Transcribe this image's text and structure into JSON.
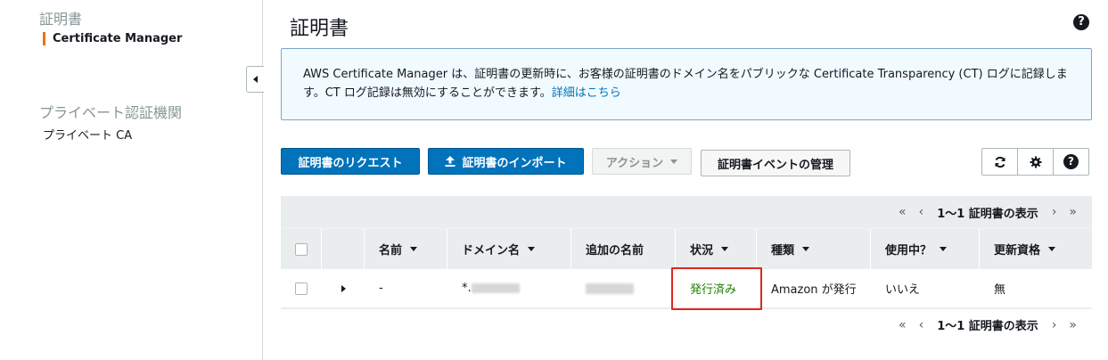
{
  "sidebar": {
    "section1": "証明書",
    "item_cm": "Certificate Manager",
    "section2": "プライベート認証機関",
    "item_ca": "プライベート CA"
  },
  "header": {
    "title": "証明書",
    "help": "?"
  },
  "info": {
    "text": "AWS Certificate Manager は、証明書の更新時に、お客様の証明書のドメイン名をパブリックな Certificate Transparency (CT) ログに記録します。CT ログ記録は無効にすることができます。",
    "link": "詳細はこちら"
  },
  "toolbar": {
    "request": "証明書のリクエスト",
    "import": "証明書のインポート",
    "actions": "アクション",
    "events": "証明書イベントの管理"
  },
  "pager": {
    "first": "«",
    "prev": "‹",
    "text": "1〜1 証明書の表示",
    "next": "›",
    "last": "»"
  },
  "table": {
    "headers": {
      "name": "名前",
      "domain": "ドメイン名",
      "additional": "追加の名前",
      "status": "状況",
      "type": "種類",
      "in_use": "使用中？",
      "renewal": "更新資格"
    },
    "rows": [
      {
        "name": "-",
        "domain_prefix": "*.",
        "status": "発行済み",
        "type": "Amazon が発行",
        "in_use": "いいえ",
        "renewal": "無"
      }
    ]
  },
  "colors": {
    "primary": "#0073bb",
    "status_issued": "#1d8102",
    "sidebar_accent": "#ec7211",
    "highlight": "#e0271c"
  }
}
